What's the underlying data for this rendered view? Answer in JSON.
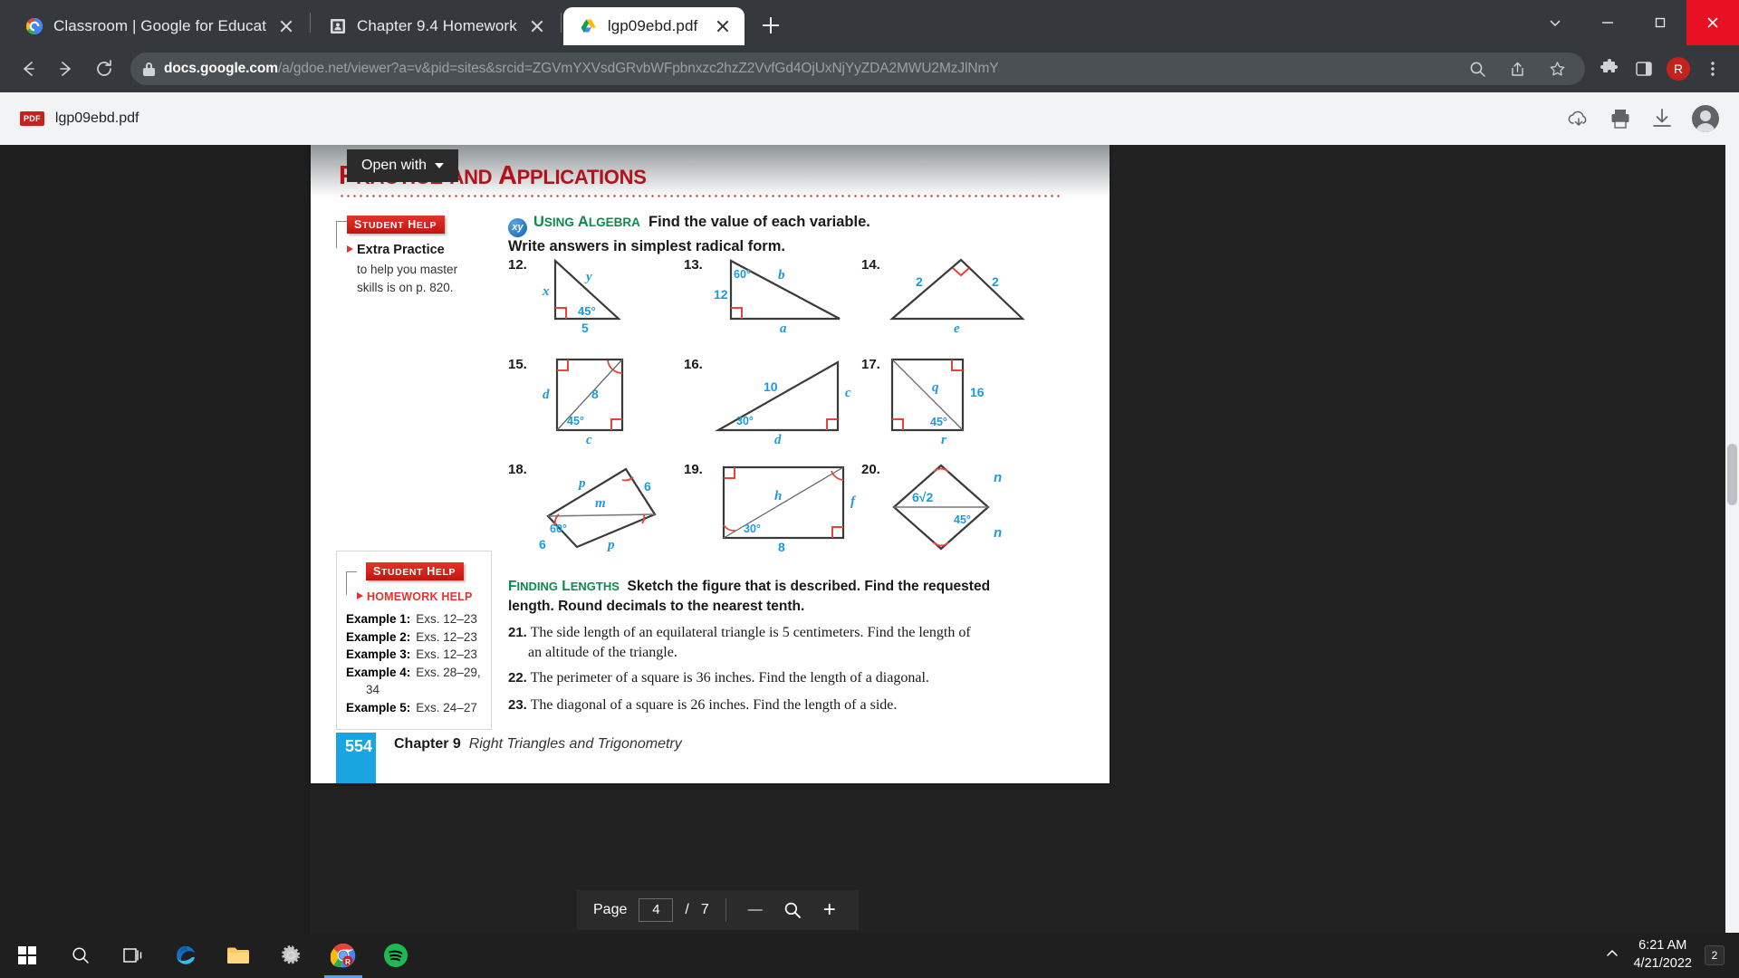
{
  "browser": {
    "tabs": [
      {
        "title": "Classroom | Google for Education",
        "favicon": "google-classroom-icon",
        "active": false
      },
      {
        "title": "Chapter 9.4 Homework",
        "favicon": "document-icon",
        "active": false
      },
      {
        "title": "lgp09ebd.pdf",
        "favicon": "google-drive-icon",
        "active": true
      }
    ],
    "new_tab_label": "+",
    "url_domain": "docs.google.com",
    "url_path": "/a/gdoe.net/viewer?a=v&pid=sites&srcid=ZGVmYXVsdGRvbWFpbnxzc2hzZ2VvfGd4OjUxNjYyZDA2MWU2MzJlNmY",
    "profile_initial": "R",
    "toolbar_icons": [
      "back-icon",
      "forward-icon",
      "reload-icon",
      "zoom-search-icon",
      "share-icon",
      "bookmark-star-icon",
      "extensions-puzzle-icon",
      "sidepanel-icon",
      "profile-avatar",
      "kebab-menu-icon"
    ],
    "window_icons": [
      "chevron-down-icon",
      "minimize-icon",
      "maximize-icon",
      "close-icon"
    ]
  },
  "viewer": {
    "file_badge": "PDF",
    "file_name": "lgp09ebd.pdf",
    "open_with_label": "Open with",
    "actions": [
      "add-to-drive-icon",
      "print-icon",
      "download-icon",
      "account-avatar"
    ],
    "pagebar": {
      "page_label": "Page",
      "current_page": "4",
      "separator": "/",
      "total_pages": "7",
      "zoom_out_label": "—",
      "zoom_label": "zoom-icon",
      "zoom_in_label": "+"
    }
  },
  "document": {
    "heading_1": "P",
    "heading_1_rest": "RACTICE",
    "heading_and": "AND",
    "heading_2": "A",
    "heading_2_rest": "PPLICATIONS",
    "student_help_top": {
      "badge_first": "S",
      "badge_rest": "TUDENT",
      "badge_first2": "H",
      "badge_rest2": "ELP",
      "subtitle": "Extra Practice",
      "body": "to help you master skills is on p. 820."
    },
    "using_algebra": {
      "badge": "xy",
      "title_s": "U",
      "title_rest": "SING",
      "title_a": "A",
      "title_rest2": "LGEBRA",
      "instruction_1": "Find the value of each variable.",
      "instruction_2": "Write answers in simplest radical form."
    },
    "student_help_bottom": {
      "badge_first": "S",
      "badge_rest": "TUDENT",
      "badge_first2": "H",
      "badge_rest2": "ELP",
      "subtitle": "HOMEWORK HELP",
      "rows": [
        {
          "label": "Example 1:",
          "value": "Exs. 12–23"
        },
        {
          "label": "Example 2:",
          "value": "Exs. 12–23"
        },
        {
          "label": "Example 3:",
          "value": "Exs. 12–23"
        },
        {
          "label": "Example 4:",
          "value": "Exs. 28–29,"
        },
        {
          "label": "",
          "value": "34"
        },
        {
          "label": "Example 5:",
          "value": "Exs. 24–27"
        }
      ]
    },
    "finding_lengths": {
      "title_f": "F",
      "title_rest": "INDING",
      "title_l": "L",
      "title_rest2": "ENGTHS",
      "instruction_1": "Sketch the figure that is described. Find the requested",
      "instruction_2": "length. Round decimals to the nearest tenth."
    },
    "word_problems": [
      {
        "num": "21.",
        "line1": "The side length of an equilateral triangle is 5 centimeters. Find the length of",
        "line2": "an altitude of the triangle."
      },
      {
        "num": "22.",
        "line1": "The perimeter of a square is 36 inches. Find the length of a diagonal.",
        "line2": ""
      },
      {
        "num": "23.",
        "line1": "The diagonal of a square is 26 inches. Find the length of a side.",
        "line2": ""
      }
    ],
    "footer": {
      "page_number": "554",
      "chapter": "Chapter 9",
      "chapter_title": "Right Triangles and Trigonometry"
    },
    "figures": [
      {
        "num": "12.",
        "shape": "right-triangle",
        "labels": {
          "left": "x",
          "hyp": "y",
          "angle": "45°",
          "base": "5"
        }
      },
      {
        "num": "13.",
        "shape": "right-triangle",
        "labels": {
          "left": "12",
          "angle": "60°",
          "hyp": "b",
          "base": "a"
        }
      },
      {
        "num": "14.",
        "shape": "isosceles-triangle",
        "labels": {
          "left": "2",
          "right": "2",
          "base": "e"
        }
      },
      {
        "num": "15.",
        "shape": "square-with-diagonal",
        "labels": {
          "left": "d",
          "diagonal": "8",
          "angle": "45°",
          "base": "c"
        }
      },
      {
        "num": "16.",
        "shape": "right-triangle",
        "labels": {
          "hyp": "10",
          "right": "c",
          "angle": "30°",
          "base": "d"
        }
      },
      {
        "num": "17.",
        "shape": "square-with-diagonal",
        "labels": {
          "diagonal": "q",
          "right": "16",
          "angle": "45°",
          "base": "r"
        }
      },
      {
        "num": "18.",
        "shape": "rotated-rectangle",
        "labels": {
          "upper": "p",
          "right": "6",
          "middle": "m",
          "angle": "60°",
          "left": "6",
          "bottom": "p"
        }
      },
      {
        "num": "19.",
        "shape": "rectangle-with-diagonal",
        "labels": {
          "diagonal": "h",
          "right": "f",
          "angle": "30°",
          "base": "8"
        }
      },
      {
        "num": "20.",
        "shape": "rhombus",
        "labels": {
          "top_right": "n",
          "horizontal": "6√2",
          "angle": "45°",
          "bottom_right": "n"
        }
      }
    ]
  },
  "taskbar": {
    "items": [
      "start-icon",
      "search-icon",
      "task-view-icon",
      "edge-icon",
      "file-explorer-icon",
      "settings-icon",
      "chrome-icon",
      "spotify-icon"
    ],
    "tray": {
      "chevron": "show-hidden-icons",
      "time": "6:21 AM",
      "date": "4/21/2022",
      "notification_count": "2"
    }
  }
}
